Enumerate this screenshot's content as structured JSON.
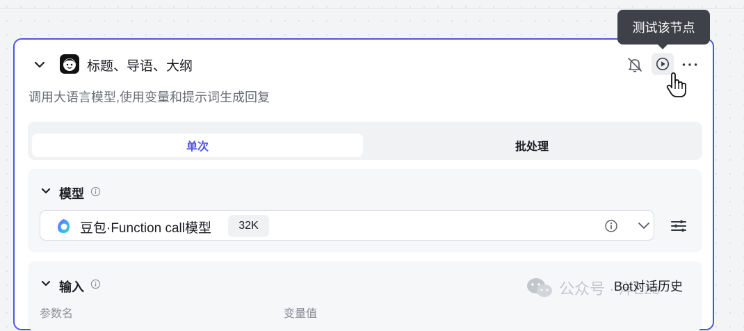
{
  "node": {
    "title": "标题、导语、大纲",
    "description": "调用大语言模型,使用变量和提示词生成回复",
    "header_icons": [
      "bell-off-icon",
      "play-circle-icon",
      "more-horizontal-icon"
    ]
  },
  "tooltip": {
    "text": "测试该节点"
  },
  "tabs": {
    "single": "单次",
    "batch": "批处理",
    "active": "single"
  },
  "model_section": {
    "title": "模型",
    "model_name": "豆包·Function call模型",
    "context_badge": "32K"
  },
  "input_section": {
    "title": "输入",
    "columns": [
      "参数名",
      "变量值"
    ],
    "overlay_label": "Bot对话历史"
  },
  "watermark": {
    "text": "公众号 · 洋Eze"
  },
  "colors": {
    "accent": "#4d53e8",
    "tooltip_bg": "#3f4148",
    "section_bg": "#f6f7f9"
  }
}
